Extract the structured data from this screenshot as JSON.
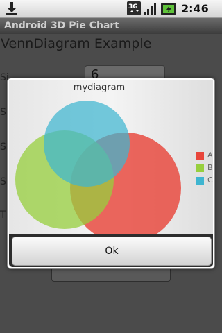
{
  "status_bar": {
    "time": "2:46 pm",
    "network_label": "3G",
    "icons": [
      "download-icon",
      "3g-network-icon",
      "signal-icon",
      "battery-charging-icon"
    ]
  },
  "app": {
    "title": "Android 3D Pie Chart"
  },
  "background": {
    "heading": "VennDiagram Example",
    "rows": [
      "Si",
      "Si",
      "Si",
      "Si",
      "T"
    ],
    "first_row_label": "Si",
    "input_value": "6"
  },
  "dialog": {
    "ok_label": "Ok"
  },
  "chart_data": {
    "type": "venn",
    "title": "mydiagram",
    "legend_position": "right",
    "sets": [
      {
        "name": "A",
        "color": "#e8463b"
      },
      {
        "name": "B",
        "color": "#97cf3d"
      },
      {
        "name": "C",
        "color": "#3fb5d0"
      }
    ]
  },
  "colors": {
    "background": "#4b4b4b",
    "set_a": "#e8463b",
    "set_b": "#97cf3d",
    "set_c": "#3fb5d0"
  }
}
